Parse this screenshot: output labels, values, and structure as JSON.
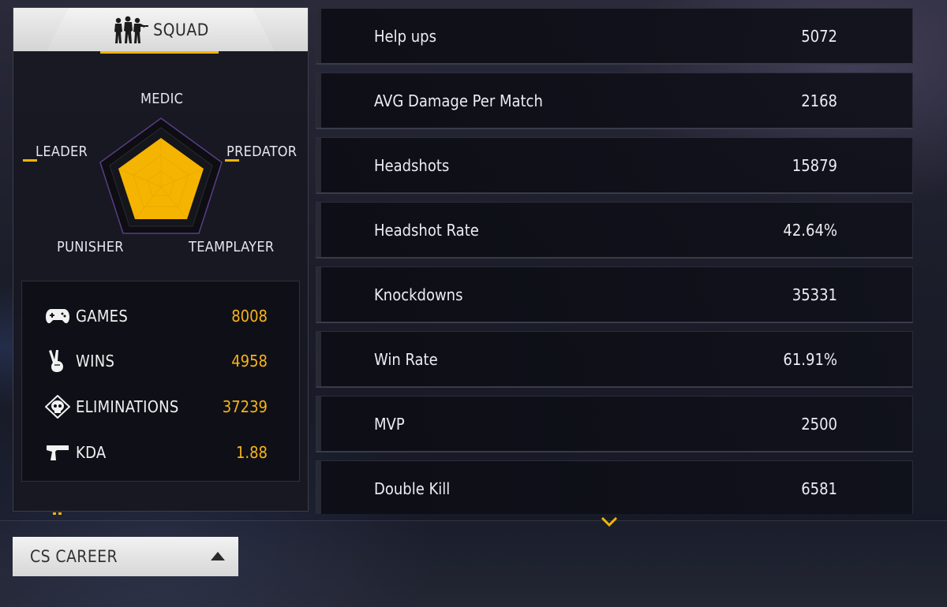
{
  "mode": {
    "title": "SQUAD",
    "icon": "squad-soldiers-icon"
  },
  "radar": {
    "labels": {
      "medic": "MEDIC",
      "leader": "LEADER",
      "predator": "PREDATOR",
      "punisher": "PUNISHER",
      "teamplayer": "TEAMPLAYER"
    },
    "fill_color": "#F5B400"
  },
  "summary": {
    "games": {
      "label": "GAMES",
      "value": "8008",
      "icon": "gamepad-icon"
    },
    "wins": {
      "label": "WINS",
      "value": "4958",
      "icon": "victory-hand-icon"
    },
    "eliminations": {
      "label": "ELIMINATIONS",
      "value": "37239",
      "icon": "skull-icon"
    },
    "kda": {
      "label": "KDA",
      "value": "1.88",
      "icon": "pistol-icon"
    }
  },
  "career_dropdown": {
    "label": "CS CAREER",
    "icon": "caret-up-icon"
  },
  "stats": [
    {
      "label": "Help ups",
      "value": "5072"
    },
    {
      "label": "AVG Damage Per Match",
      "value": "2168"
    },
    {
      "label": "Headshots",
      "value": "15879"
    },
    {
      "label": "Headshot Rate",
      "value": "42.64%"
    },
    {
      "label": "Knockdowns",
      "value": "35331"
    },
    {
      "label": "Win Rate",
      "value": "61.91%"
    },
    {
      "label": "MVP",
      "value": "2500"
    },
    {
      "label": "Double Kill",
      "value": "6581"
    }
  ],
  "colors": {
    "accent": "#F5B400",
    "value_yellow": "#F7B21A",
    "text_light": "#ECEDF3"
  }
}
